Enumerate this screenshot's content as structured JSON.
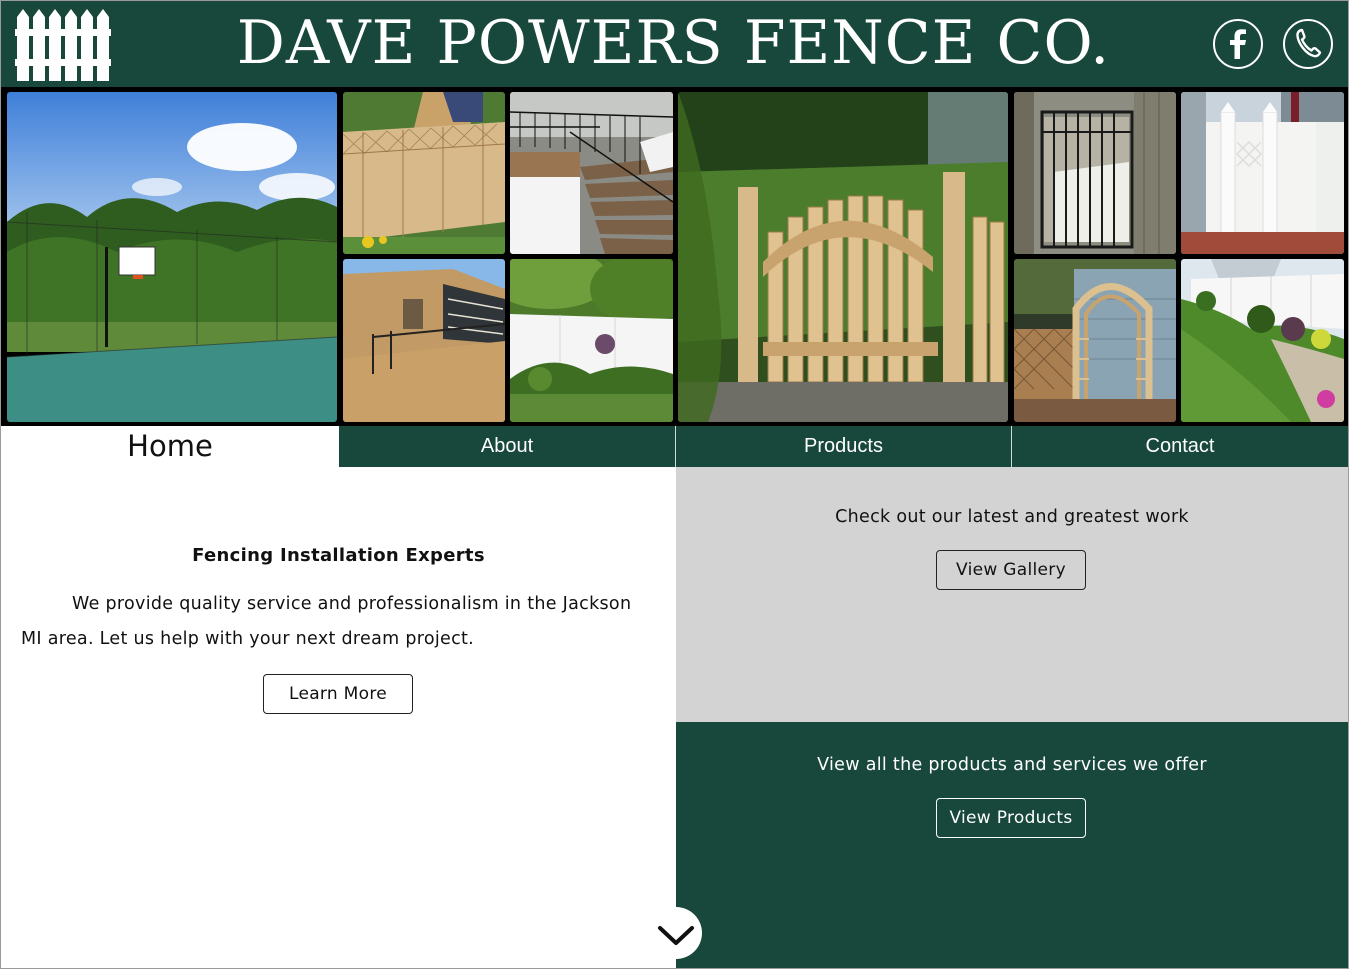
{
  "header": {
    "title": "DAVE POWERS FENCE CO.",
    "logo_icon": "picket-fence-icon",
    "social": [
      {
        "name": "facebook-icon"
      },
      {
        "name": "phone-icon"
      }
    ]
  },
  "gallery": {
    "tiles": [
      {
        "name": "photo-basketball-court"
      },
      {
        "name": "photo-wood-lattice-fence"
      },
      {
        "name": "photo-black-railing-stairs"
      },
      {
        "name": "photo-chain-link-fence"
      },
      {
        "name": "photo-white-vinyl-fence"
      },
      {
        "name": "photo-wood-arched-gate"
      },
      {
        "name": "photo-black-metal-gate"
      },
      {
        "name": "photo-white-vinyl-gate"
      },
      {
        "name": "photo-wood-arbor"
      },
      {
        "name": "photo-vinyl-fence-garden"
      }
    ]
  },
  "nav": {
    "items": [
      "Home",
      "About",
      "Products",
      "Contact"
    ],
    "active": "Home"
  },
  "intro": {
    "title": "Fencing Installation Experts",
    "text": "We provide quality service and professionalism in the Jackson MI area. Let us help with your next dream project.",
    "button": "Learn More"
  },
  "gallery_panel": {
    "text": "Check out our latest and greatest work",
    "button": "View Gallery"
  },
  "products_panel": {
    "text": "View all the products and services we offer",
    "button": "View Products"
  },
  "scroll": {
    "icon": "chevron-down-icon"
  },
  "colors": {
    "brand_green": "#18473c",
    "panel_gray": "#d3d3d3"
  }
}
